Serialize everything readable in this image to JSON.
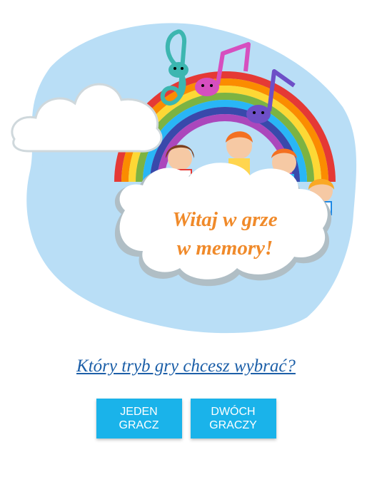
{
  "welcome": {
    "line1": "Witaj w grze",
    "line2": "w memory!"
  },
  "question": "Który tryb gry chcesz wybrać?",
  "buttons": {
    "single_player": "JEDEN GRACZ",
    "two_players": "DWÓCH GRACZY"
  },
  "colors": {
    "welcome_text": "#f08a2a",
    "question_text": "#1c5fa8",
    "button_bg": "#1ab3ea",
    "sky_splash": "#b9def6"
  },
  "illustration": {
    "icons": [
      "rainbow-icon",
      "cloud-icon",
      "treble-clef-icon",
      "music-note-icon",
      "children-icon"
    ]
  }
}
